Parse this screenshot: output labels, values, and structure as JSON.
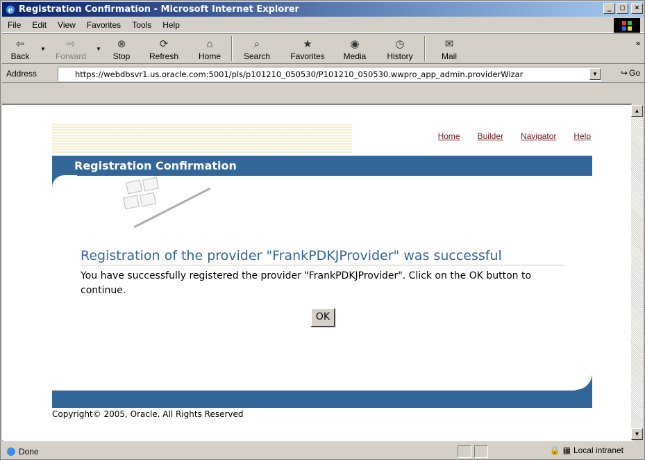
{
  "window": {
    "title": "Registration Confirmation - Microsoft Internet Explorer",
    "min": "_",
    "max": "□",
    "close": "×"
  },
  "menu": [
    "File",
    "Edit",
    "View",
    "Favorites",
    "Tools",
    "Help"
  ],
  "toolbar": {
    "back": "Back",
    "forward": "Forward",
    "stop": "Stop",
    "refresh": "Refresh",
    "home": "Home",
    "search": "Search",
    "favorites": "Favorites",
    "media": "Media",
    "history": "History",
    "mail": "Mail",
    "chevron": "»"
  },
  "address": {
    "label": "Address",
    "url": "https://webdbsvr1.us.oracle.com:5001/pls/p101210_050530/P101210_050530.wwpro_app_admin.providerWizar",
    "go": "Go"
  },
  "page": {
    "links": [
      "Home",
      "Builder",
      "Navigator",
      "Help"
    ],
    "banner_title": "Registration Confirmation",
    "heading": "Registration of the provider \"FrankPDKJProvider\" was successful",
    "message": "You have successfully registered the provider \"FrankPDKJProvider\". Click on the OK button to continue.",
    "ok": "OK",
    "copyright": "Copyright© 2005, Oracle. All Rights Reserved"
  },
  "status": {
    "text": "Done",
    "zone": "Local intranet"
  },
  "colors": {
    "band": "#336699",
    "heading": "#336699",
    "link": "#6a1a1a"
  }
}
